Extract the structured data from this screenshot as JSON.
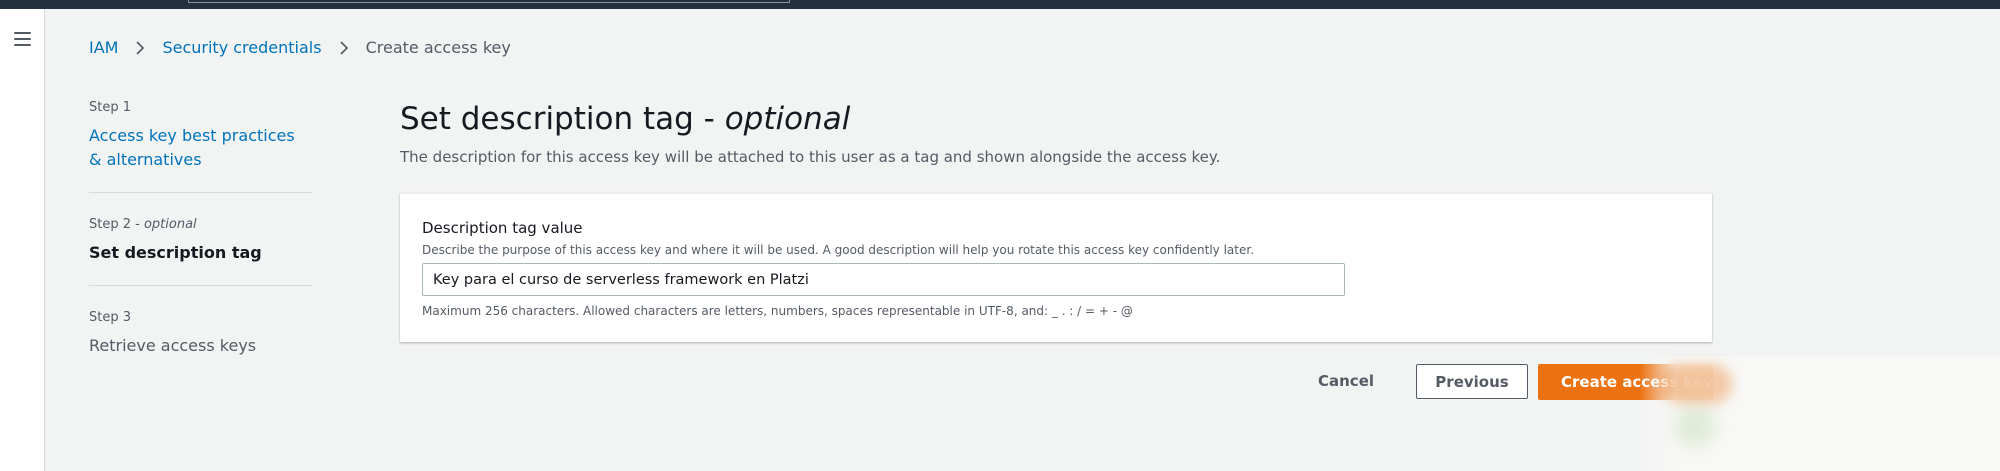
{
  "breadcrumb": {
    "items": [
      {
        "label": "IAM"
      },
      {
        "label": "Security credentials"
      },
      {
        "label": "Create access key"
      }
    ]
  },
  "steps": [
    {
      "label": "Step 1",
      "optional": "",
      "title": "Access key best practices & alternatives"
    },
    {
      "label": "Step 2 - ",
      "optional": "optional",
      "title": "Set description tag"
    },
    {
      "label": "Step 3",
      "optional": "",
      "title": "Retrieve access keys"
    }
  ],
  "header": {
    "title": "Set description tag - ",
    "title_optional": "optional",
    "description": "The description for this access key will be attached to this user as a tag and shown alongside the access key."
  },
  "form": {
    "label": "Description tag value",
    "description": "Describe the purpose of this access key and where it will be used. A good description will help you rotate this access key confidently later.",
    "value": "Key para el curso de serverless framework en Platzi",
    "constraint": "Maximum 256 characters. Allowed characters are letters, numbers, spaces representable in UTF-8, and: _ . : / = + - @"
  },
  "actions": {
    "cancel": "Cancel",
    "previous": "Previous",
    "create": "Create access key"
  },
  "icons": {
    "menu": "hamburger-menu-icon",
    "separator": "chevron-right-icon"
  },
  "colors": {
    "link": "#0073bb",
    "primary_button": "#ec7211",
    "nav_dark": "#232f3e"
  }
}
